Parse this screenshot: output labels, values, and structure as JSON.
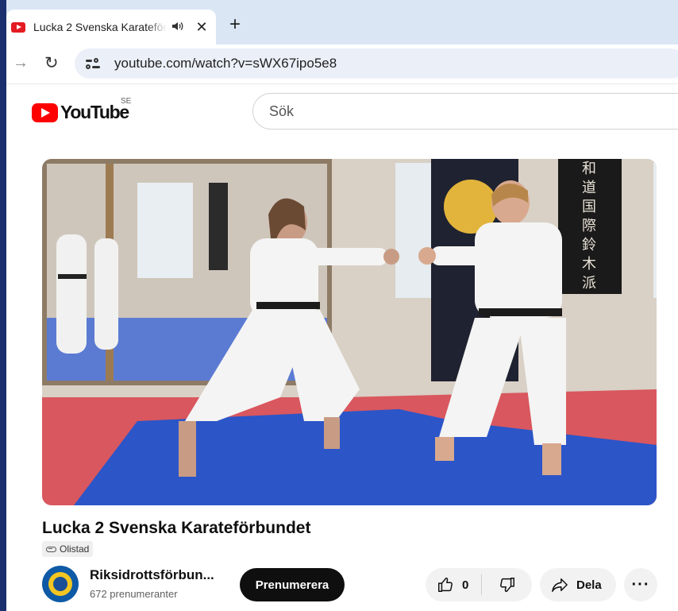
{
  "browser": {
    "tab": {
      "title": "Lucka 2 Svenska Karateförbundet",
      "audio_icon": "speaker-icon",
      "close_glyph": "✕"
    },
    "new_tab_glyph": "+",
    "forward_glyph": "→",
    "reload_glyph": "↻",
    "url": "youtube.com/watch?v=sWX67ipo5e8"
  },
  "youtube": {
    "logo_text": "YouTube",
    "region": "SE",
    "search_placeholder": "Sök"
  },
  "video": {
    "title": "Lucka 2 Svenska Karateförbundet",
    "visibility": "Olistad"
  },
  "channel": {
    "name": "Riksidrottsförbun...",
    "subscribers": "672 prenumeranter",
    "subscribe_label": "Prenumerera"
  },
  "actions": {
    "like_count": "0",
    "share_label": "Dela",
    "more_glyph": "···"
  },
  "colors": {
    "brand_red": "#ff0000",
    "tabstrip": "#dbe6f5",
    "omnibox": "#ebf0f8"
  }
}
